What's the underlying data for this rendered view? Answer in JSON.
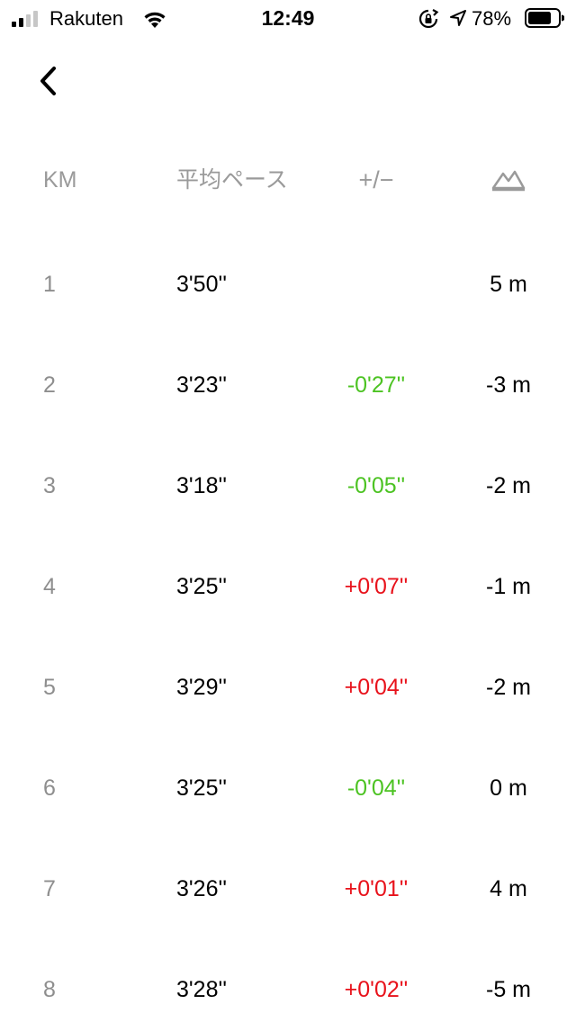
{
  "status_bar": {
    "carrier": "Rakuten",
    "time": "12:49",
    "battery_percent": "78%",
    "battery_level": 0.78,
    "signal_bars": 2,
    "icons": [
      "signal-icon",
      "wifi-icon",
      "orientation-lock-icon",
      "location-arrow-icon",
      "battery-icon"
    ]
  },
  "nav": {
    "back_icon": "chevron-left-icon"
  },
  "table": {
    "headers": {
      "km": "KM",
      "pace": "平均ペース",
      "diff": "+/−",
      "elevation_icon": "mountain-icon"
    },
    "rows": [
      {
        "km": "1",
        "pace": "3'50''",
        "diff": "",
        "diff_sign": "none",
        "elevation": "5 m"
      },
      {
        "km": "2",
        "pace": "3'23''",
        "diff": "-0'27''",
        "diff_sign": "neg",
        "elevation": "-3 m"
      },
      {
        "km": "3",
        "pace": "3'18''",
        "diff": "-0'05''",
        "diff_sign": "neg",
        "elevation": "-2 m"
      },
      {
        "km": "4",
        "pace": "3'25''",
        "diff": "+0'07''",
        "diff_sign": "pos",
        "elevation": "-1 m"
      },
      {
        "km": "5",
        "pace": "3'29''",
        "diff": "+0'04''",
        "diff_sign": "pos",
        "elevation": "-2 m"
      },
      {
        "km": "6",
        "pace": "3'25''",
        "diff": "-0'04''",
        "diff_sign": "neg",
        "elevation": "0 m"
      },
      {
        "km": "7",
        "pace": "3'26''",
        "diff": "+0'01''",
        "diff_sign": "pos",
        "elevation": "4 m"
      },
      {
        "km": "8",
        "pace": "3'28''",
        "diff": "+0'02''",
        "diff_sign": "pos",
        "elevation": "-5 m"
      }
    ]
  },
  "colors": {
    "faster": "#4cc322",
    "slower": "#e8121b",
    "header_text": "#9a9a9a",
    "km_text": "#8e8e8e"
  }
}
